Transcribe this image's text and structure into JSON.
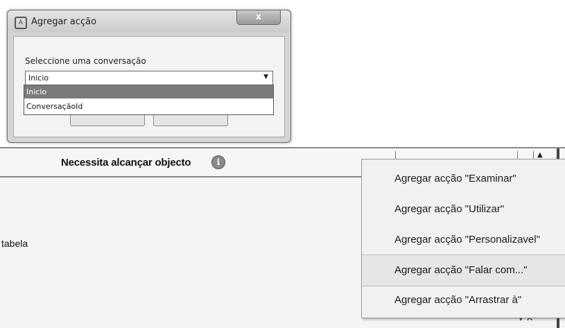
{
  "dialog": {
    "title": "Agregar acção",
    "close_label": "x",
    "label": "Seleccione uma conversação",
    "selected_value": "Inicio",
    "options": [
      "Inicio",
      "ConversaçãoId"
    ]
  },
  "editor": {
    "header_title": "Necessita alcançar objecto",
    "row_label": "tabela"
  },
  "context_menu": {
    "items": [
      "Agregar acção \"Examinar\"",
      "Agregar acção  \"Utilizar\"",
      "Agregar acção \"Personalizavel\"",
      "Agregar acção  \"Falar com...\"",
      "Agregar acção \"Arrastrar à\""
    ],
    "highlighted_index": 3
  }
}
